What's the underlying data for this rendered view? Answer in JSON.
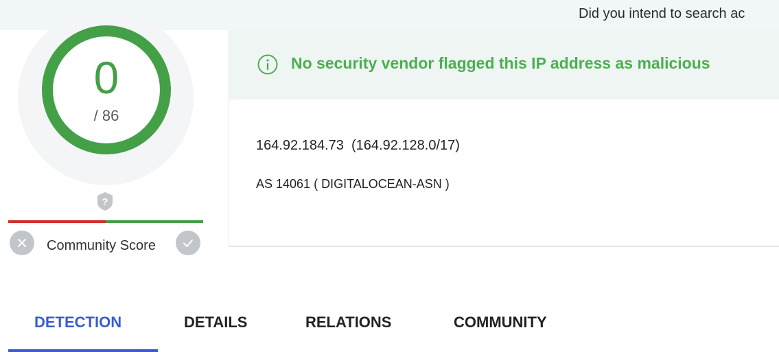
{
  "banner": {
    "intend_text": "Did you intend to search ac"
  },
  "score": {
    "value": "0",
    "total": "/ 86",
    "detected": 0,
    "engines": 86,
    "ring_color": "#43a047"
  },
  "community": {
    "label": "Community Score",
    "down_icon": "close-icon",
    "up_icon": "check-icon",
    "help_icon": "question-icon"
  },
  "verdict": {
    "icon": "info-icon",
    "text": "No security vendor flagged this IP address as malicious",
    "color": "#4caf50"
  },
  "ip": {
    "line": "164.92.184.73  (164.92.128.0/17)",
    "as_line": "AS 14061 ( DIGITALOCEAN-ASN )"
  },
  "tabs": [
    {
      "label": "DETECTION",
      "active": true
    },
    {
      "label": "DETAILS",
      "active": false
    },
    {
      "label": "RELATIONS",
      "active": false
    },
    {
      "label": "COMMUNITY",
      "active": false
    }
  ],
  "colors": {
    "accent": "#3a5bd0",
    "malicious": "#d32f2f",
    "harmless": "#43a047"
  }
}
